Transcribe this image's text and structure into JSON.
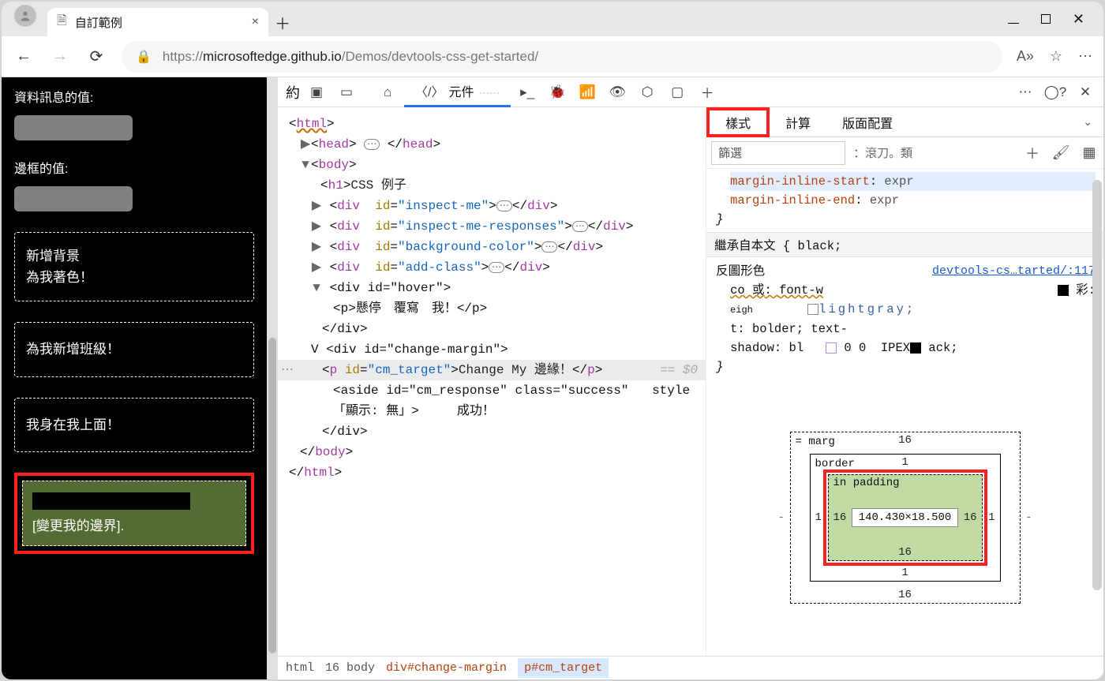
{
  "browser": {
    "tab_title": "自訂範例",
    "url_display": {
      "prefix": "https://",
      "host_path": "microsoftedge.github.io",
      "rest": "/Demos/devtools-css-get-started/"
    }
  },
  "page": {
    "data_info_label": "資料訊息的值:",
    "border_value_label": "邊框的值:",
    "boxes": {
      "add_bg_line1": "新增背景",
      "add_bg_line2": "為我著色！",
      "add_class": "為我新增班級！",
      "hover_over": "我身在我上面！",
      "change_margin": "[變更我的邊界]."
    }
  },
  "devtools": {
    "welcome": "約",
    "tabs": {
      "elements_icon_label": "元件",
      "placeholder": "......"
    },
    "dom": {
      "html_open": "html",
      "head": "head",
      "body": "body",
      "h1_text": "CSS 例子",
      "insp": "inspect-me",
      "insp_resp": "inspect-me-responses",
      "bgcolor": "background-color",
      "addclass": "add-class",
      "hover_id": "hover",
      "hover_p_text": "懸停　覆寫　我！",
      "cm_div": "change-margin",
      "cm_target": "cm_target",
      "cm_text": "Change My 邊緣！",
      "cm_resp": "cm_response",
      "cm_resp_class": "success",
      "cm_resp_style": "style",
      "cm_resp_body1": "「顯示: 無」>",
      "cm_resp_body2": "成功！",
      "dollar": "== $0"
    },
    "styles_pane": {
      "tabs": {
        "styles": "樣式",
        "computed": "計算",
        "layout": "版面配置"
      },
      "filter_placeholder": "篩選",
      "cls_hint": "：滾刀。類",
      "rule1_prop1": "margin-inline-start",
      "rule1_val1": "expr",
      "rule1_prop2": "margin-inline-end",
      "rule1_val2": "expr",
      "inherit_label": "繼承自本文",
      "inherit_color": "black",
      "selector2": "反圖形色",
      "source_link": "devtools-cs…tarted/:117",
      "decl2a_name": "co 或",
      "decl2a_val": "font-w",
      "decl2a_right": "彩:",
      "decl2b_pre": "eigh",
      "decl2b_val": "lightgray;",
      "decl2c": "t: bolder; text-",
      "decl2d_name": "shadow:",
      "decl2d_mid": "bl",
      "decl2d_r1": "0 0",
      "decl2d_r2": "IPEX",
      "decl2d_r3": "ack;"
    },
    "boxmodel": {
      "margin_label": "= marg",
      "border_label": "border",
      "padding_label": "in padding",
      "m_top": "16",
      "m_right": "-",
      "m_bottom": "16",
      "m_left": "-",
      "b_top": "1",
      "b_right": "1",
      "b_bottom": "1",
      "b_left": "1",
      "p_top": "",
      "p_right": "16",
      "p_bottom": "16",
      "p_left": "16",
      "content": "140.430×18.500"
    },
    "breadcrumb": {
      "html": "html",
      "body_prefix": "16 body",
      "div": "div#change-margin",
      "p": "p#cm_target"
    }
  }
}
